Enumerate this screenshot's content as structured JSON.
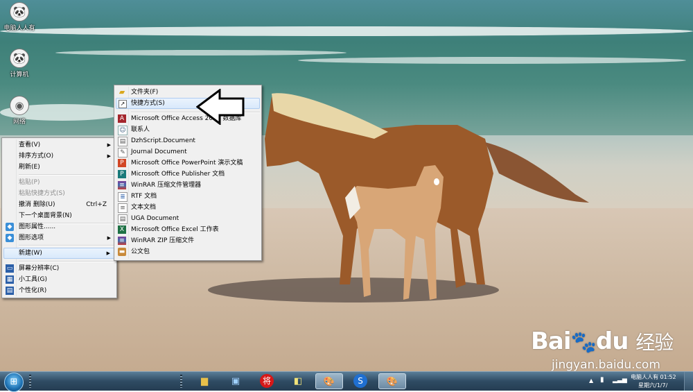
{
  "desktop": {
    "icons": [
      {
        "label": "电脑人人有",
        "icon": "panda-user-icon"
      },
      {
        "label": "计算机",
        "icon": "computer-icon"
      },
      {
        "label": "网络",
        "icon": "network-icon"
      }
    ]
  },
  "context_menu": {
    "items": [
      {
        "label": "查看(V)",
        "submenu": true
      },
      {
        "label": "排序方式(O)",
        "submenu": true
      },
      {
        "label": "刷新(E)"
      },
      {
        "label": "粘贴(P)",
        "disabled": true
      },
      {
        "label": "粘贴快捷方式(S)",
        "disabled": true
      },
      {
        "label": "撤消 删除(U)",
        "shortcut": "Ctrl+Z"
      },
      {
        "label": "下一个桌面背景(N)"
      },
      {
        "label": "图形属性......",
        "icon": "intel-graphics-icon"
      },
      {
        "label": "图形选项",
        "icon": "intel-graphics-icon",
        "submenu": true
      },
      {
        "label": "新建(W)",
        "submenu": true,
        "highlighted": true
      },
      {
        "label": "屏幕分辨率(C)",
        "icon": "monitor-icon"
      },
      {
        "label": "小工具(G)",
        "icon": "gadgets-icon"
      },
      {
        "label": "个性化(R)",
        "icon": "personalize-icon"
      }
    ]
  },
  "new_submenu": {
    "items": [
      {
        "label": "文件夹(F)",
        "icon": "folder-icon"
      },
      {
        "label": "快捷方式(S)",
        "icon": "shortcut-icon",
        "highlighted": true
      },
      {
        "label": "Microsoft Office Access 2007 数据库",
        "icon": "access-icon"
      },
      {
        "label": "联系人",
        "icon": "contact-icon"
      },
      {
        "label": "DzhScript.Document",
        "icon": "document-icon"
      },
      {
        "label": "Journal Document",
        "icon": "journal-icon"
      },
      {
        "label": "Microsoft Office PowerPoint 演示文稿",
        "icon": "powerpoint-icon"
      },
      {
        "label": "Microsoft Office Publisher 文档",
        "icon": "publisher-icon"
      },
      {
        "label": "WinRAR 压缩文件管理器",
        "icon": "winrar-icon"
      },
      {
        "label": "RTF 文档",
        "icon": "rtf-icon"
      },
      {
        "label": "文本文档",
        "icon": "text-file-icon"
      },
      {
        "label": "UGA Document",
        "icon": "document-icon"
      },
      {
        "label": "Microsoft Office Excel 工作表",
        "icon": "excel-icon"
      },
      {
        "label": "WinRAR ZIP 压缩文件",
        "icon": "winrar-zip-icon"
      },
      {
        "label": "公文包",
        "icon": "briefcase-icon"
      }
    ]
  },
  "taskbar": {
    "start_icon": "windows-orb-icon",
    "buttons": [
      {
        "icon": "explorer-folder-icon"
      },
      {
        "icon": "remote-desktop-icon"
      },
      {
        "icon": "chess-app-icon",
        "glyph": "将"
      },
      {
        "icon": "notes-icon"
      },
      {
        "icon": "paint-icon",
        "active": true
      },
      {
        "icon": "sogou-icon"
      },
      {
        "icon": "paint-icon",
        "active": true
      }
    ],
    "clock": {
      "user": "电脑人人有",
      "time": "01:52",
      "date": "星期六/1/7/"
    }
  },
  "watermark": {
    "brand_left": "Bai",
    "brand_right": "du",
    "brand_cn": "经验",
    "url": "jingyan.baidu.com"
  },
  "colors": {
    "menu_bg": "#f0f0f0",
    "highlight": "#d9e9fb",
    "taskbar": "#2f4b63"
  }
}
